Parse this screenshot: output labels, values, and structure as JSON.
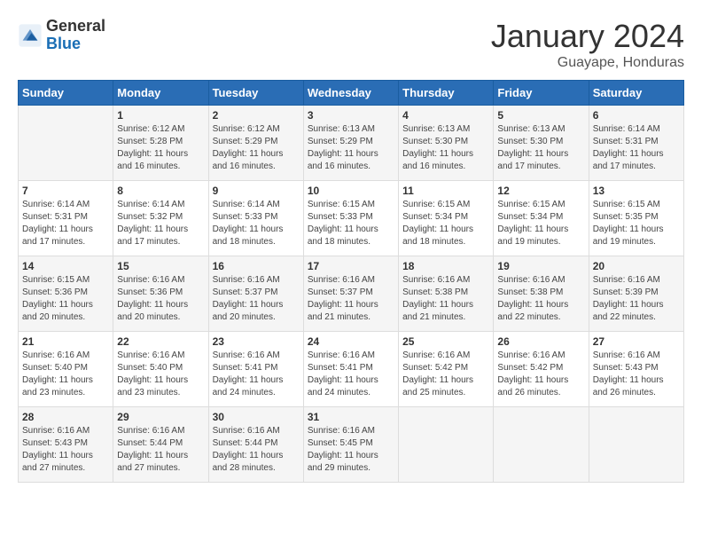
{
  "logo": {
    "general": "General",
    "blue": "Blue"
  },
  "title": "January 2024",
  "location": "Guayape, Honduras",
  "days_header": [
    "Sunday",
    "Monday",
    "Tuesday",
    "Wednesday",
    "Thursday",
    "Friday",
    "Saturday"
  ],
  "weeks": [
    [
      {
        "day": "",
        "info": ""
      },
      {
        "day": "1",
        "info": "Sunrise: 6:12 AM\nSunset: 5:28 PM\nDaylight: 11 hours\nand 16 minutes."
      },
      {
        "day": "2",
        "info": "Sunrise: 6:12 AM\nSunset: 5:29 PM\nDaylight: 11 hours\nand 16 minutes."
      },
      {
        "day": "3",
        "info": "Sunrise: 6:13 AM\nSunset: 5:29 PM\nDaylight: 11 hours\nand 16 minutes."
      },
      {
        "day": "4",
        "info": "Sunrise: 6:13 AM\nSunset: 5:30 PM\nDaylight: 11 hours\nand 16 minutes."
      },
      {
        "day": "5",
        "info": "Sunrise: 6:13 AM\nSunset: 5:30 PM\nDaylight: 11 hours\nand 17 minutes."
      },
      {
        "day": "6",
        "info": "Sunrise: 6:14 AM\nSunset: 5:31 PM\nDaylight: 11 hours\nand 17 minutes."
      }
    ],
    [
      {
        "day": "7",
        "info": "Sunrise: 6:14 AM\nSunset: 5:31 PM\nDaylight: 11 hours\nand 17 minutes."
      },
      {
        "day": "8",
        "info": "Sunrise: 6:14 AM\nSunset: 5:32 PM\nDaylight: 11 hours\nand 17 minutes."
      },
      {
        "day": "9",
        "info": "Sunrise: 6:14 AM\nSunset: 5:33 PM\nDaylight: 11 hours\nand 18 minutes."
      },
      {
        "day": "10",
        "info": "Sunrise: 6:15 AM\nSunset: 5:33 PM\nDaylight: 11 hours\nand 18 minutes."
      },
      {
        "day": "11",
        "info": "Sunrise: 6:15 AM\nSunset: 5:34 PM\nDaylight: 11 hours\nand 18 minutes."
      },
      {
        "day": "12",
        "info": "Sunrise: 6:15 AM\nSunset: 5:34 PM\nDaylight: 11 hours\nand 19 minutes."
      },
      {
        "day": "13",
        "info": "Sunrise: 6:15 AM\nSunset: 5:35 PM\nDaylight: 11 hours\nand 19 minutes."
      }
    ],
    [
      {
        "day": "14",
        "info": "Sunrise: 6:15 AM\nSunset: 5:36 PM\nDaylight: 11 hours\nand 20 minutes."
      },
      {
        "day": "15",
        "info": "Sunrise: 6:16 AM\nSunset: 5:36 PM\nDaylight: 11 hours\nand 20 minutes."
      },
      {
        "day": "16",
        "info": "Sunrise: 6:16 AM\nSunset: 5:37 PM\nDaylight: 11 hours\nand 20 minutes."
      },
      {
        "day": "17",
        "info": "Sunrise: 6:16 AM\nSunset: 5:37 PM\nDaylight: 11 hours\nand 21 minutes."
      },
      {
        "day": "18",
        "info": "Sunrise: 6:16 AM\nSunset: 5:38 PM\nDaylight: 11 hours\nand 21 minutes."
      },
      {
        "day": "19",
        "info": "Sunrise: 6:16 AM\nSunset: 5:38 PM\nDaylight: 11 hours\nand 22 minutes."
      },
      {
        "day": "20",
        "info": "Sunrise: 6:16 AM\nSunset: 5:39 PM\nDaylight: 11 hours\nand 22 minutes."
      }
    ],
    [
      {
        "day": "21",
        "info": "Sunrise: 6:16 AM\nSunset: 5:40 PM\nDaylight: 11 hours\nand 23 minutes."
      },
      {
        "day": "22",
        "info": "Sunrise: 6:16 AM\nSunset: 5:40 PM\nDaylight: 11 hours\nand 23 minutes."
      },
      {
        "day": "23",
        "info": "Sunrise: 6:16 AM\nSunset: 5:41 PM\nDaylight: 11 hours\nand 24 minutes."
      },
      {
        "day": "24",
        "info": "Sunrise: 6:16 AM\nSunset: 5:41 PM\nDaylight: 11 hours\nand 24 minutes."
      },
      {
        "day": "25",
        "info": "Sunrise: 6:16 AM\nSunset: 5:42 PM\nDaylight: 11 hours\nand 25 minutes."
      },
      {
        "day": "26",
        "info": "Sunrise: 6:16 AM\nSunset: 5:42 PM\nDaylight: 11 hours\nand 26 minutes."
      },
      {
        "day": "27",
        "info": "Sunrise: 6:16 AM\nSunset: 5:43 PM\nDaylight: 11 hours\nand 26 minutes."
      }
    ],
    [
      {
        "day": "28",
        "info": "Sunrise: 6:16 AM\nSunset: 5:43 PM\nDaylight: 11 hours\nand 27 minutes."
      },
      {
        "day": "29",
        "info": "Sunrise: 6:16 AM\nSunset: 5:44 PM\nDaylight: 11 hours\nand 27 minutes."
      },
      {
        "day": "30",
        "info": "Sunrise: 6:16 AM\nSunset: 5:44 PM\nDaylight: 11 hours\nand 28 minutes."
      },
      {
        "day": "31",
        "info": "Sunrise: 6:16 AM\nSunset: 5:45 PM\nDaylight: 11 hours\nand 29 minutes."
      },
      {
        "day": "",
        "info": ""
      },
      {
        "day": "",
        "info": ""
      },
      {
        "day": "",
        "info": ""
      }
    ]
  ]
}
